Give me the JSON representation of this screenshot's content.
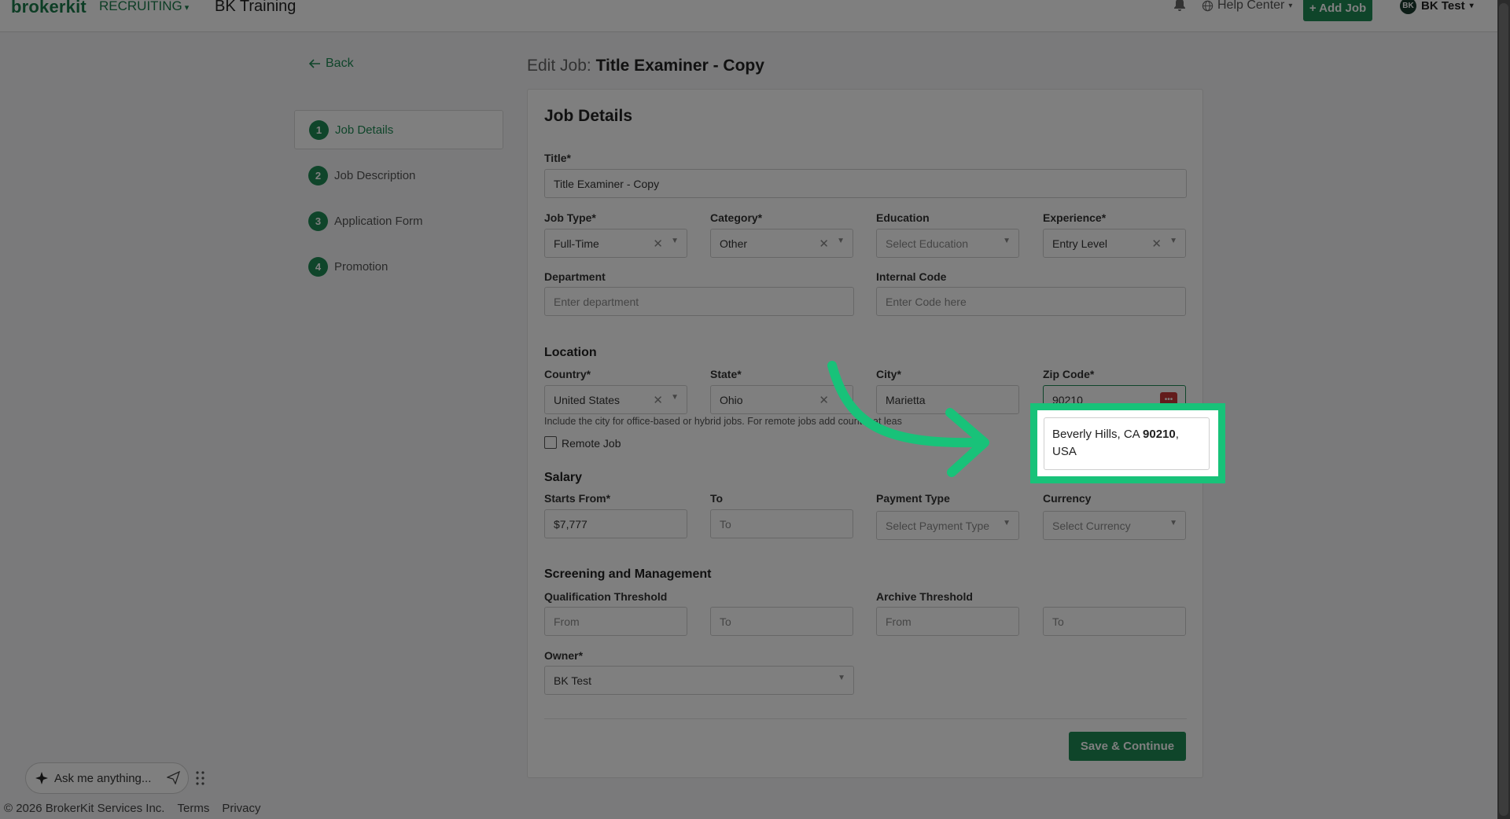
{
  "header": {
    "logo": "brokerkit",
    "module": "RECRUITING",
    "org": "BK Training",
    "help": "Help Center",
    "add_job": "+ Add Job",
    "avatar": "BK",
    "user": "BK Test"
  },
  "nav": {
    "back": "Back",
    "steps": [
      {
        "num": "1",
        "label": "Job Details"
      },
      {
        "num": "2",
        "label": "Job Description"
      },
      {
        "num": "3",
        "label": "Application Form"
      },
      {
        "num": "4",
        "label": "Promotion"
      }
    ]
  },
  "page": {
    "title_prefix": "Edit Job:",
    "title": "Title Examiner - Copy"
  },
  "form": {
    "heading": "Job Details",
    "title_label": "Title*",
    "title_value": "Title Examiner - Copy",
    "job_type_label": "Job Type*",
    "job_type_value": "Full-Time",
    "category_label": "Category*",
    "category_value": "Other",
    "education_label": "Education",
    "education_placeholder": "Select Education",
    "experience_label": "Experience*",
    "experience_value": "Entry Level",
    "department_label": "Department",
    "department_placeholder": "Enter department",
    "internal_code_label": "Internal Code",
    "internal_code_placeholder": "Enter Code here",
    "location_heading": "Location",
    "country_label": "Country*",
    "country_value": "United States",
    "state_label": "State*",
    "state_value": "Ohio",
    "city_label": "City*",
    "city_value": "Marietta",
    "zip_label": "Zip Code*",
    "zip_value": "90210",
    "location_hint": "Include the city for office-based or hybrid jobs. For remote jobs add country at leas",
    "remote_label": "Remote Job",
    "salary_heading": "Salary",
    "starts_label": "Starts From*",
    "starts_value": "$7,777",
    "to_label": "To",
    "to_placeholder": "To",
    "payment_label": "Payment Type",
    "payment_placeholder": "Select Payment Type",
    "currency_label": "Currency",
    "currency_placeholder": "Select Currency",
    "screening_heading": "Screening and Management",
    "qual_label": "Qualification Threshold",
    "qual_from": "From",
    "qual_to": "To",
    "archive_label": "Archive Threshold",
    "archive_from": "From",
    "archive_to": "To",
    "owner_label": "Owner*",
    "owner_value": "BK Test",
    "save": "Save & Continue"
  },
  "suggestion": {
    "line1_prefix": "Beverly Hills, CA ",
    "line1_bold": "90210",
    "line1_suffix": ",",
    "line2": "USA"
  },
  "assistant": {
    "placeholder": "Ask me anything..."
  },
  "footer": {
    "copyright": "© 2026 BrokerKit Services Inc.",
    "terms": "Terms",
    "privacy": "Privacy"
  },
  "colors": {
    "brand": "#1f8a55",
    "highlight": "#18c279"
  }
}
